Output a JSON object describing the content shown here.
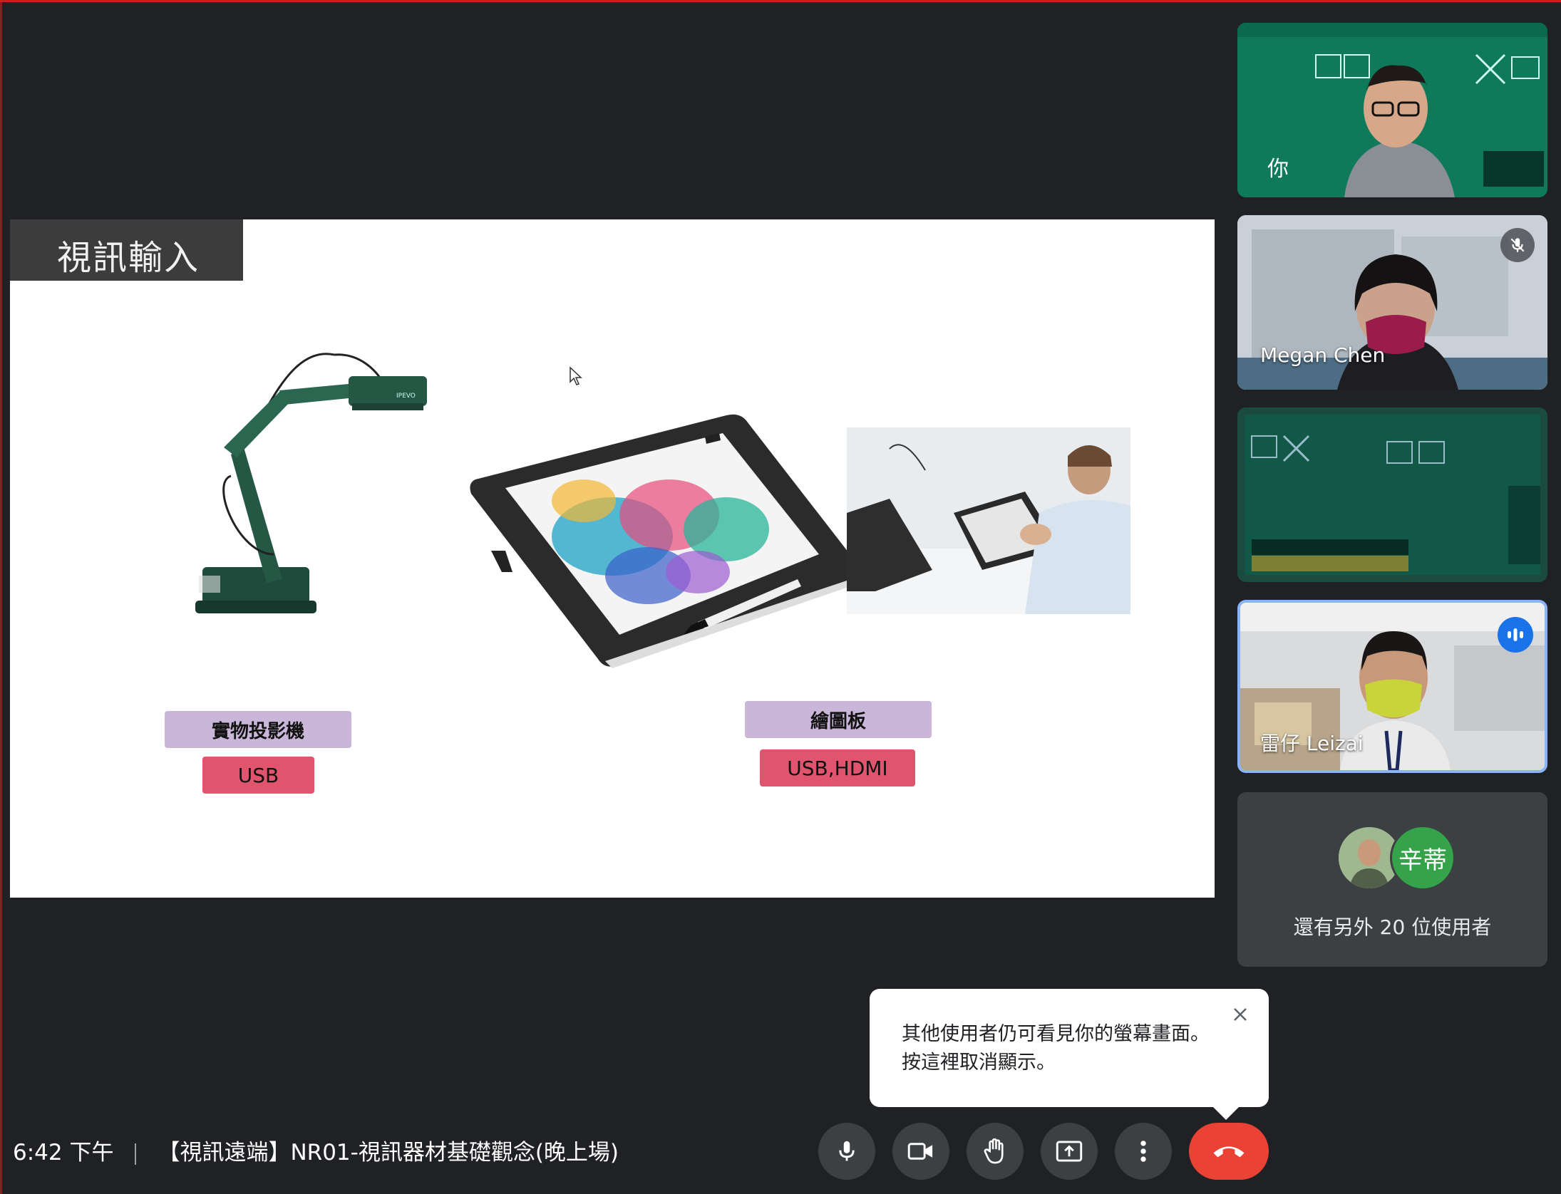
{
  "slide": {
    "title": "視訊輸入",
    "doc_camera": {
      "name": "實物投影機",
      "port": "USB"
    },
    "drawing_tablet": {
      "name": "繪圖板",
      "port": "USB,HDMI"
    }
  },
  "participants": {
    "self": {
      "label": "你"
    },
    "megan": {
      "name": "Megan Chen",
      "muted": true
    },
    "leizai": {
      "name": "雷仔 Leizai",
      "speaking": true
    },
    "others": {
      "avatar_initials": "辛蒂",
      "text": "還有另外 20 位使用者"
    }
  },
  "tooltip": {
    "line1": "其他使用者仍可看見你的螢幕畫面。",
    "line2": "按這裡取消顯示。"
  },
  "meeting": {
    "time": "6:42 下午",
    "title": "【視訊遠端】NR01-視訊器材基礎觀念(晚上場)"
  },
  "colors": {
    "accent": "#1a73e8",
    "hangup": "#ea4335",
    "bar_bg": "#202124"
  }
}
